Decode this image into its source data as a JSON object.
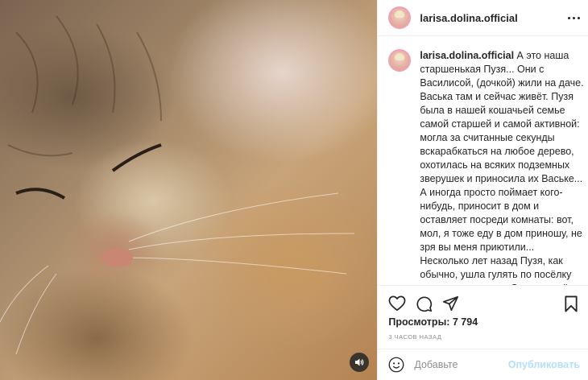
{
  "post": {
    "username": "larisa.dolina.official",
    "caption": "А это наша старшенькая Пузя... Они с Василисой, (дочкой) жили на даче. Васька там и сейчас живёт. Пузя была в нашей кошачьей семье самой старшей и самой активной: могла за считанные секунды вскарабкаться на любое дерево, охотилась на всяких подземных зверушек и приносила их Ваське... А иногда просто поймает кого-нибудь, приносит в дом и оставляет посреди комнаты: вот, мол, я тоже еду в дом приношу, не зря вы меня приютили... Несколько лет назад Пузя, как обычно, ушла гулять по посёлку и... не вернулась... Сколько слёз я пролила... Мы взяли её котёнком: её мама пришла рожать котят в наш гараж, благополучно разродилась, потом сбежала, котята",
    "views": "Просмотры: 7 794",
    "time": "3 ЧАСОВ НАЗАД"
  },
  "comment": {
    "placeholder": "Добавьте",
    "publish_label": "Опубликовать"
  },
  "icons": {
    "like": "heart-icon",
    "comment": "comment-icon",
    "share": "share-icon",
    "save": "bookmark-icon",
    "sound": "speaker-icon",
    "more": "more-icon",
    "emoji": "emoji-icon"
  },
  "colors": {
    "publish": "#b2dffc",
    "text": "#262626",
    "muted": "#8e8e8e",
    "border": "#efefef"
  }
}
